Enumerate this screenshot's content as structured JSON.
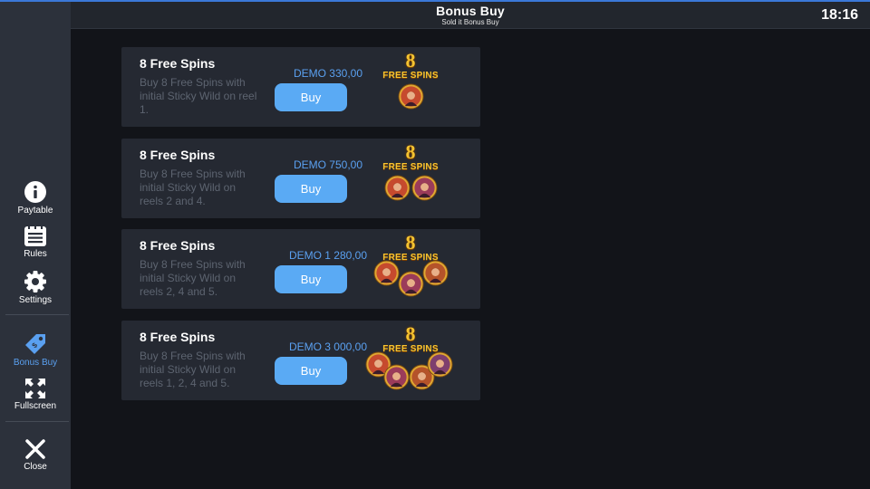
{
  "header": {
    "title": "Bonus Buy",
    "subtitle": "Sold it Bonus Buy",
    "clock": "18:16"
  },
  "sidebar": {
    "items": [
      {
        "label": "Paytable",
        "icon": "info-icon"
      },
      {
        "label": "Rules",
        "icon": "rules-icon"
      },
      {
        "label": "Settings",
        "icon": "gear-icon"
      },
      {
        "label": "Bonus Buy",
        "icon": "tag-icon",
        "active": true
      },
      {
        "label": "Fullscreen",
        "icon": "fullscreen-icon"
      },
      {
        "label": "Close",
        "icon": "close-icon"
      }
    ]
  },
  "offers": [
    {
      "title": "8 Free Spins",
      "description": "Buy 8 Free Spins with initial Sticky Wild on reel 1.",
      "price": "DEMO 330,00",
      "button": "Buy",
      "emblem_number": "8",
      "emblem_text": "FREE SPINS",
      "wild_count": 1
    },
    {
      "title": "8 Free Spins",
      "description": "Buy 8 Free Spins with initial Sticky Wild on reels 2 and 4.",
      "price": "DEMO 750,00",
      "button": "Buy",
      "emblem_number": "8",
      "emblem_text": "FREE SPINS",
      "wild_count": 2
    },
    {
      "title": "8 Free Spins",
      "description": "Buy 8 Free Spins with initial Sticky Wild on reels 2, 4 and 5.",
      "price": "DEMO 1 280,00",
      "button": "Buy",
      "emblem_number": "8",
      "emblem_text": "FREE SPINS",
      "wild_count": 3
    },
    {
      "title": "8 Free Spins",
      "description": "Buy 8 Free Spins with initial Sticky Wild on reels 1, 2, 4 and 5.",
      "price": "DEMO 3 000,00",
      "button": "Buy",
      "emblem_number": "8",
      "emblem_text": "FREE SPINS",
      "wild_count": 4
    }
  ],
  "colors": {
    "accent": "#5aa0f0",
    "button": "#5aaaf4",
    "gold": "#f5c431",
    "card": "#252932",
    "sidebar": "#2c313b"
  }
}
